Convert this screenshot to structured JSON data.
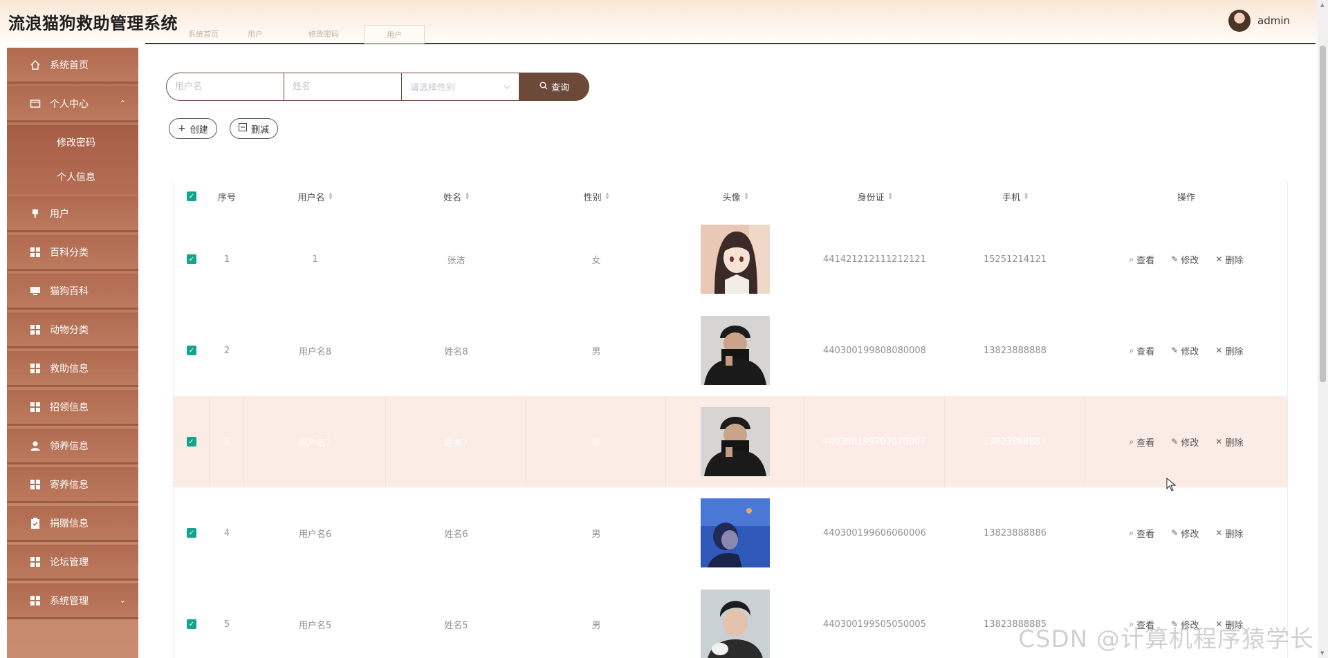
{
  "app": {
    "title": "流浪猫狗救助管理系统"
  },
  "header": {
    "tags": [
      "系统首页",
      "用户",
      "修改密码",
      "用户"
    ],
    "user_name": "admin"
  },
  "sidebar": {
    "items": [
      {
        "label": "系统首页",
        "icon": "home-icon"
      },
      {
        "label": "个人中心",
        "icon": "wallet-icon",
        "chevron": "⌃"
      },
      {
        "label": "修改密码"
      },
      {
        "label": "个人信息"
      },
      {
        "label": "用户",
        "icon": "pin-icon"
      },
      {
        "label": "百科分类",
        "icon": "grid-icon"
      },
      {
        "label": "猫狗百科",
        "icon": "monitor-icon"
      },
      {
        "label": "动物分类",
        "icon": "grid-icon"
      },
      {
        "label": "救助信息",
        "icon": "grid-icon"
      },
      {
        "label": "招领信息",
        "icon": "grid-icon"
      },
      {
        "label": "领养信息",
        "icon": "user-icon"
      },
      {
        "label": "寄养信息",
        "icon": "grid-icon"
      },
      {
        "label": "捐赠信息",
        "icon": "clipboard-icon"
      },
      {
        "label": "论坛管理",
        "icon": "grid-icon"
      },
      {
        "label": "系统管理",
        "icon": "grid-icon",
        "chevron": "⌄"
      }
    ]
  },
  "search": {
    "username_placeholder": "用户名",
    "name_placeholder": "姓名",
    "gender_placeholder": "请选择性别",
    "query_label": "查询"
  },
  "actions": {
    "create_label": "创建",
    "delete_label": "删减"
  },
  "table": {
    "headers": [
      "序号",
      "用户名",
      "姓名",
      "性别",
      "头像",
      "身份证",
      "手机",
      "操作"
    ],
    "rows": [
      {
        "index": "1",
        "username": "1",
        "name": "张洁",
        "gender": "女",
        "id_card": "441421212111212121",
        "phone": "15251214121",
        "avatar": "anime-girl"
      },
      {
        "index": "2",
        "username": "用户名8",
        "name": "姓名8",
        "gender": "男",
        "id_card": "440300199808080008",
        "phone": "13823888888",
        "avatar": "man-black-hat"
      },
      {
        "index": "3",
        "username": "用户名7",
        "name": "姓名7",
        "gender": "男",
        "id_card": "440300199707070007",
        "phone": "13823888887",
        "avatar": "man-black-hat"
      },
      {
        "index": "4",
        "username": "用户名6",
        "name": "姓名6",
        "gender": "男",
        "id_card": "440300199606060006",
        "phone": "13823888886",
        "avatar": "man-blue-water"
      },
      {
        "index": "5",
        "username": "用户名5",
        "name": "姓名5",
        "gender": "男",
        "id_card": "440300199505050005",
        "phone": "13823888885",
        "avatar": "man-with-cat"
      }
    ],
    "ops": {
      "view": "查看",
      "edit": "修改",
      "delete": "删除"
    }
  },
  "watermark": "CSDN @计算机程序猿学长",
  "colors": {
    "sidebar": "#b7735a",
    "query_button": "#6b4a3a",
    "checkbox": "#13a58b",
    "hover_row": "#fcece6"
  }
}
